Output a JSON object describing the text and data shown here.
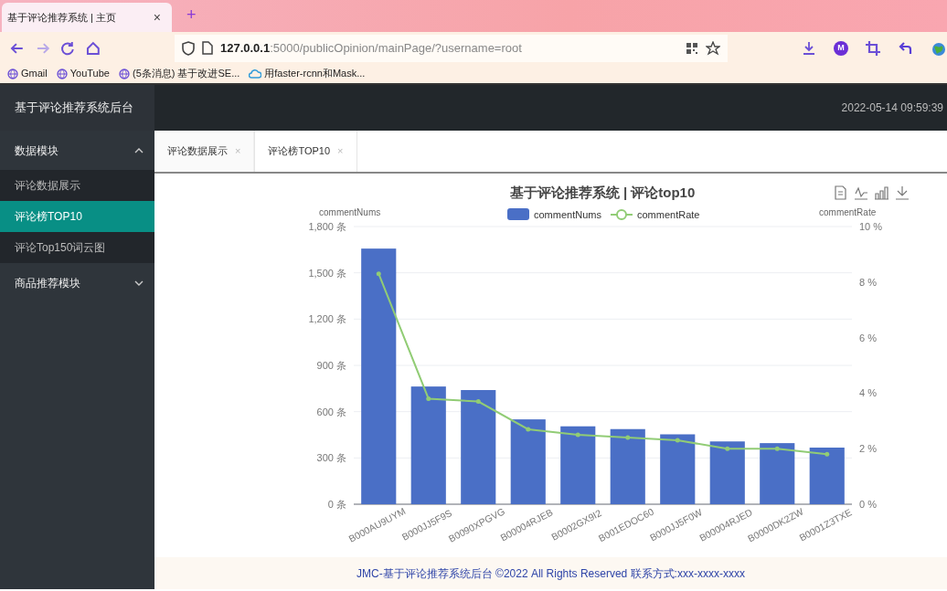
{
  "browser": {
    "tab": {
      "title": "基于评论推荐系统 | 主页",
      "close": "×"
    },
    "new_tab": "+",
    "url": "**127.0.0.1**:5000/publicOpinion/mainPage/?username=root",
    "profile_badge": "M",
    "bookmarks": [
      {
        "label": "Gmail",
        "kind": "globe"
      },
      {
        "label": "YouTube",
        "kind": "globe"
      },
      {
        "label": "(5条消息) 基于改进SE...",
        "kind": "globe"
      },
      {
        "label": "用faster-rcnn和Mask...",
        "kind": "cloud"
      }
    ]
  },
  "app": {
    "brand": "基于评论推荐系统后台",
    "clock": "2022-05-14 09:59:39",
    "sidebar": {
      "groups": [
        {
          "label": "数据模块",
          "expanded": true,
          "children": [
            {
              "label": "评论数据展示",
              "selected": false
            },
            {
              "label": "评论榜TOP10",
              "selected": true
            },
            {
              "label": "评论Top150词云图",
              "selected": false
            }
          ]
        },
        {
          "label": "商品推荐模块",
          "expanded": false
        }
      ]
    },
    "tabs": [
      {
        "label": "评论数据展示",
        "close": "×",
        "selected": false
      },
      {
        "label": "评论榜TOP10",
        "close": "×",
        "selected": true
      }
    ],
    "bar_chart": {
      "chart_data": {
        "type": "bar",
        "title": "基于评论推荐系统 | 评论top10",
        "ylabel": "commentNums",
        "grid": true,
        "categories": [
          "B000AU9UYM",
          "B000JJ5F9S",
          "B0090XPGVG",
          "B00004RJEB",
          "B0002GX9I2",
          "B001EDOC60",
          "B000JJ5F0W",
          "B00004RJED",
          "B0000DK2ZW",
          "B0001Z3TXE"
        ],
        "series": [
          {
            "name": "commentNums",
            "color": "#4a6fc6",
            "values": [
              1657,
              763,
              740,
              550,
              505,
              487,
              453,
              407,
              396,
              367
            ]
          }
        ],
        "ylim": [
          0,
          1800
        ],
        "yticks": [
          {
            "value": 0,
            "label": "0 条"
          },
          {
            "value": 300,
            "label": "300 条"
          },
          {
            "value": 600,
            "label": "600 条"
          },
          {
            "value": 900,
            "label": "900 条"
          },
          {
            "value": 1200,
            "label": "1,200 条"
          },
          {
            "value": 1500,
            "label": "1,500 条"
          },
          {
            "value": 1800,
            "label": "1,800 条"
          }
        ]
      }
    },
    "line_chart": {
      "chart_data": {
        "type": "line",
        "ylabel": "commentRate",
        "series": [
          {
            "name": "commentRate",
            "color": "#91cc75",
            "values": [
              8.3,
              3.8,
              3.7,
              2.7,
              2.5,
              2.4,
              2.3,
              2.0,
              2.0,
              1.8
            ]
          }
        ],
        "ylim": [
          0,
          10
        ],
        "yticks": [
          {
            "value": 0,
            "label": "0 %"
          },
          {
            "value": 2,
            "label": "2 %"
          },
          {
            "value": 4,
            "label": "4 %"
          },
          {
            "value": 6,
            "label": "6 %"
          },
          {
            "value": 8,
            "label": "8 %"
          },
          {
            "value": 10,
            "label": "10 %"
          }
        ]
      }
    },
    "footer": "JMC-基于评论推荐系统后台 ©2022 All Rights Reserved 联系方式:xxx-xxxx-xxxx"
  }
}
